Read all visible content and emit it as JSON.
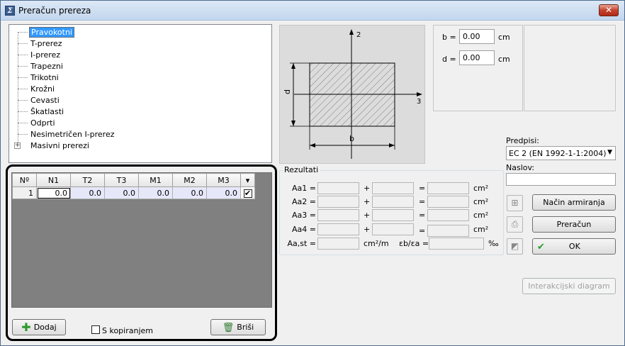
{
  "window": {
    "title": "Preračun prereza",
    "close_glyph": "✕"
  },
  "tree": {
    "items": [
      {
        "label": "Pravokotni",
        "selected": true
      },
      {
        "label": "T-prerez"
      },
      {
        "label": "I-prerez"
      },
      {
        "label": "Trapezni"
      },
      {
        "label": "Trikotni"
      },
      {
        "label": "Krožni"
      },
      {
        "label": "Cevasti"
      },
      {
        "label": "Škatlasti"
      },
      {
        "label": "Odprti"
      },
      {
        "label": "Nesimetričen I-prerez"
      },
      {
        "label": "Masivni prerezi",
        "expander": "+"
      }
    ]
  },
  "diagram": {
    "axis_2": "2",
    "axis_3": "3",
    "dim_b": "b",
    "dim_d": "d"
  },
  "dims": {
    "b_label": "b =",
    "b_value": "0.00",
    "b_unit": "cm",
    "d_label": "d =",
    "d_value": "0.00",
    "d_unit": "cm"
  },
  "predpisi": {
    "label": "Predpisi:",
    "value": "EC 2 (EN 1992-1-1:2004)"
  },
  "naslov": {
    "label": "Naslov:"
  },
  "grid": {
    "columns": [
      "Nº",
      "N1",
      "T2",
      "T3",
      "M1",
      "M2",
      "M3"
    ],
    "rows": [
      {
        "n": "1",
        "N1": "0.0",
        "T2": "0.0",
        "T3": "0.0",
        "M1": "0.0",
        "M2": "0.0",
        "M3": "0.0",
        "checked": "✔"
      }
    ],
    "dropdown_glyph": "▾"
  },
  "bottom": {
    "add": "Dodaj",
    "copy": "S kopiranjem",
    "delete": "Briši"
  },
  "results": {
    "title": "Rezultati",
    "rows": [
      {
        "label": "Aa1 =",
        "plus": "+",
        "eq": "=",
        "unit": "cm²"
      },
      {
        "label": "Aa2 =",
        "plus": "+",
        "eq": "=",
        "unit": "cm²"
      },
      {
        "label": "Aa3 =",
        "plus": "+",
        "eq": "=",
        "unit": "cm²"
      },
      {
        "label": "Aa4 =",
        "plus": "+",
        "eq": "=",
        "unit": "cm²"
      }
    ],
    "aast_label": "Aa,st =",
    "aast_unit": "cm²/m",
    "ratio_label": "εb/εa =",
    "ratio_unit": "‰"
  },
  "actions": {
    "nacin": "Način armiranja",
    "preracun": "Preračun",
    "ok": "OK",
    "interakcijski": "Interakcijski diagram"
  },
  "colors": {
    "accent": "#3399ff",
    "ok_check": "#2e9a2e",
    "add_plus": "#2e9a2e"
  }
}
